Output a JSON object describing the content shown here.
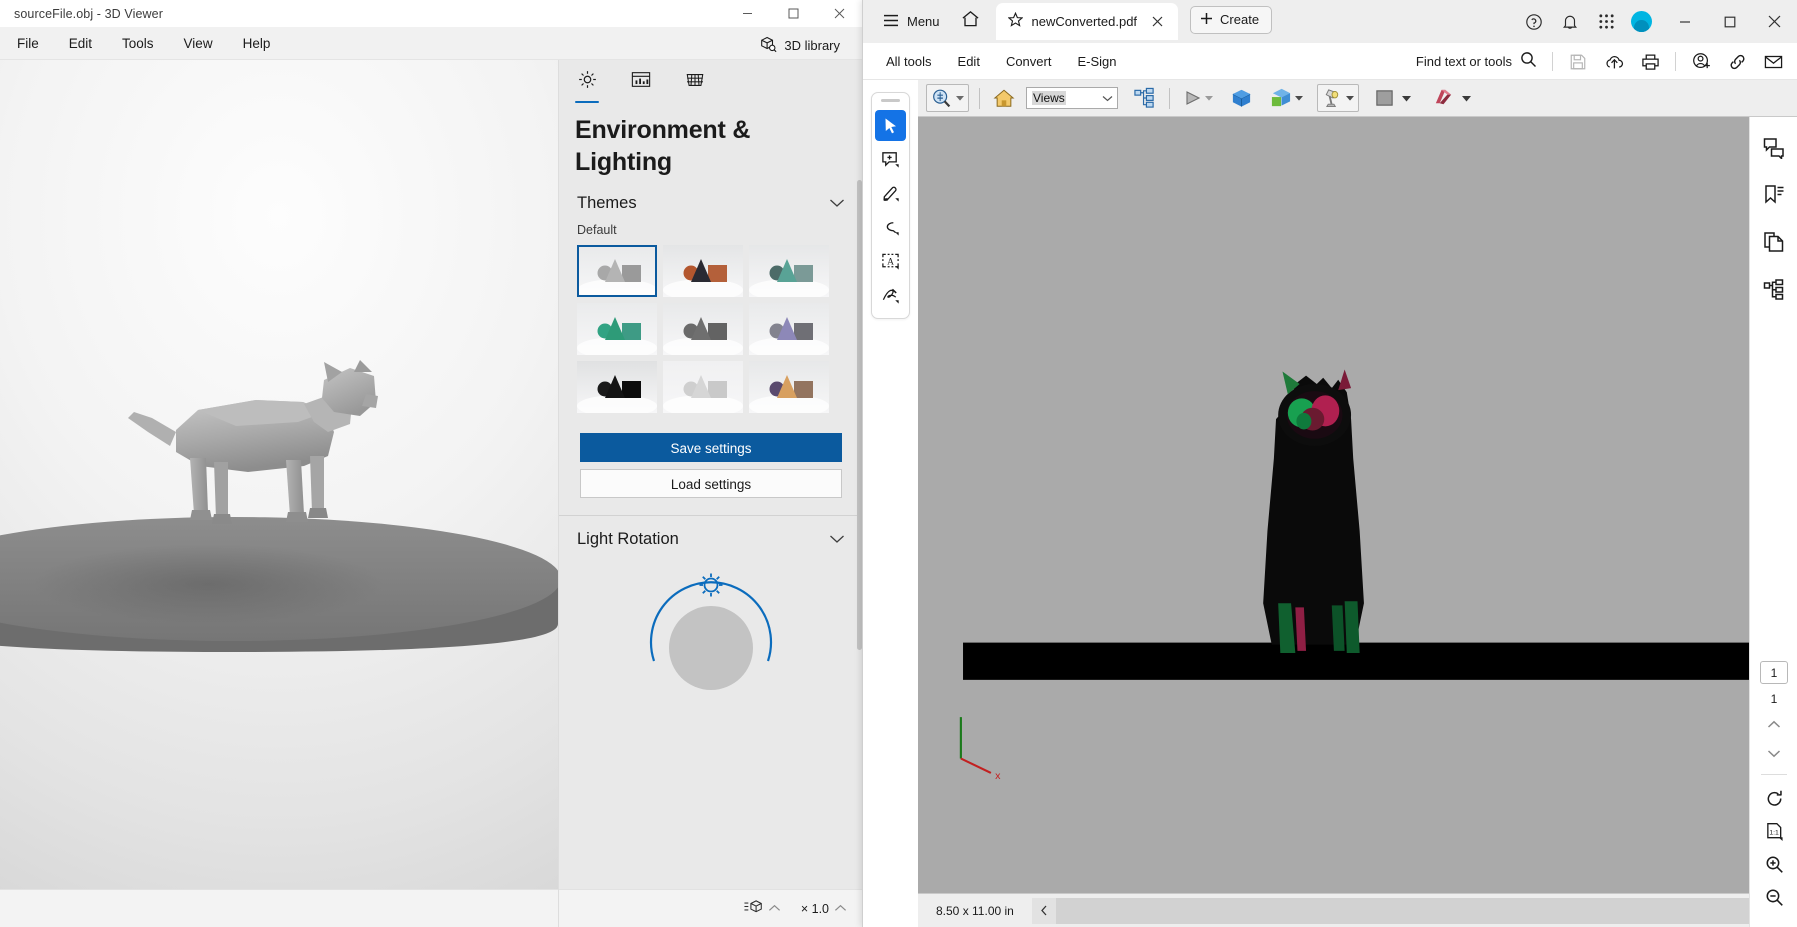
{
  "viewer": {
    "title": "sourceFile.obj - 3D Viewer",
    "window_controls": [
      {
        "name": "minimize-button",
        "glyph": "minimize"
      },
      {
        "name": "maximize-button",
        "glyph": "maximize"
      },
      {
        "name": "close-button",
        "glyph": "close"
      }
    ],
    "menu": [
      "File",
      "Edit",
      "Tools",
      "View",
      "Help"
    ],
    "library_button": {
      "label": "3D library",
      "icon": "cube-search-icon"
    },
    "panel": {
      "tabs": [
        {
          "name": "environment-lighting-tab",
          "icon": "sun-icon",
          "active": true
        },
        {
          "name": "statistics-tab",
          "icon": "chart-panel-icon",
          "active": false
        },
        {
          "name": "grid-tab",
          "icon": "grid-icon",
          "active": false
        }
      ],
      "title": "Environment & Lighting",
      "themes": {
        "section_label": "Themes",
        "group_label": "Default",
        "items": [
          {
            "name": "theme-default",
            "selected": true,
            "cone": "#b4b4b4",
            "sphere": "#a8a8a8",
            "box": "#9a9a9a",
            "bg": "#e8e9ea"
          },
          {
            "name": "theme-ember",
            "selected": false,
            "cone": "#2a2a33",
            "sphere": "#b3562e",
            "box": "#b4603a",
            "bg": "#e4e5e6"
          },
          {
            "name": "theme-teal",
            "selected": false,
            "cone": "#59a396",
            "sphere": "#4c6b68",
            "box": "#7b9a97",
            "bg": "#e6e7e8"
          },
          {
            "name": "theme-green",
            "selected": false,
            "cone": "#2e9b78",
            "sphere": "#31a383",
            "box": "#3e9b85",
            "bg": "#eaebec"
          },
          {
            "name": "theme-grey",
            "selected": false,
            "cone": "#6f6f6f",
            "sphere": "#6a6a6a",
            "box": "#636363",
            "bg": "#e8e9ea"
          },
          {
            "name": "theme-violet",
            "selected": false,
            "cone": "#8d88b8",
            "sphere": "#83838f",
            "box": "#6f6f75",
            "bg": "#e9eaeb"
          },
          {
            "name": "theme-night",
            "selected": false,
            "cone": "#151515",
            "sphere": "#1b1b1b",
            "box": "#0d0d0d",
            "bg": "#e0e1e2"
          },
          {
            "name": "theme-light",
            "selected": false,
            "cone": "#d6d6d6",
            "sphere": "#cfcfcf",
            "box": "#c9c9c9",
            "bg": "#f0f0f1"
          },
          {
            "name": "theme-sunset",
            "selected": false,
            "cone": "#d8a060",
            "sphere": "#5a4a6e",
            "box": "#93745f",
            "bg": "#e7e8e9"
          }
        ]
      },
      "save_button": "Save settings",
      "load_button": "Load settings",
      "light_rotation": {
        "section_label": "Light Rotation"
      },
      "status": {
        "model_icon_label": "model-stats-icon",
        "zoom_label": "× 1.0"
      }
    }
  },
  "acrobat": {
    "menu_button": "Menu",
    "tab": {
      "name": "newConverted.pdf",
      "star_icon": "star-icon",
      "close_icon": "close-icon"
    },
    "create_button": "Create",
    "header_icons": [
      {
        "name": "help-icon",
        "glyph": "?"
      },
      {
        "name": "notifications-bell-icon",
        "glyph": "bell"
      },
      {
        "name": "app-grid-icon",
        "glyph": "grid"
      }
    ],
    "window_controls": [
      {
        "name": "minimize-button"
      },
      {
        "name": "maximize-button"
      },
      {
        "name": "close-button"
      }
    ],
    "menubar": [
      "All tools",
      "Edit",
      "Convert",
      "E-Sign"
    ],
    "find": {
      "label": "Find text or tools",
      "icon": "search-icon"
    },
    "action_icons": [
      {
        "name": "save-icon",
        "disabled": true
      },
      {
        "name": "upload-cloud-icon",
        "disabled": false
      },
      {
        "name": "print-icon",
        "disabled": false
      },
      {
        "name": "add-person-icon",
        "disabled": false
      },
      {
        "name": "link-icon",
        "disabled": false
      },
      {
        "name": "email-icon",
        "disabled": false
      }
    ],
    "left_rail": [
      {
        "name": "select-tool",
        "icon": "cursor-arrow-icon",
        "active": true
      },
      {
        "name": "add-comment-tool",
        "icon": "comment-plus-icon",
        "active": false
      },
      {
        "name": "highlight-tool",
        "icon": "highlighter-icon",
        "active": false
      },
      {
        "name": "draw-tool",
        "icon": "lasso-icon",
        "active": false
      },
      {
        "name": "text-select-tool",
        "icon": "text-box-icon",
        "active": false
      },
      {
        "name": "signature-tool",
        "icon": "signature-pen-icon",
        "active": false
      }
    ],
    "pdf_toolbar": {
      "rotate_tool": "rotate-3d-icon",
      "home_view": "home-icon",
      "views_value": "Views",
      "model_tree": "model-tree-icon",
      "play": "play-icon",
      "cube_blue": "blue-cube-icon",
      "cube_green": "green-cube-icon",
      "lighting": "desk-lamp-icon",
      "background_color": "background-swatch-icon",
      "cross_section": "cross-section-icon"
    },
    "status": {
      "page_size": "8.50 x 11.00 in",
      "collapse_icon": "chevron-left-icon"
    },
    "right_rail": [
      {
        "name": "comment-panel-icon"
      },
      {
        "name": "bookmarks-panel-icon"
      },
      {
        "name": "page-thumbnails-icon"
      },
      {
        "name": "model-tree-panel-icon"
      }
    ],
    "page_nav": {
      "current_page": "1",
      "total_pages": "1",
      "prev_icon": "chevron-up-icon",
      "next_icon": "chevron-down-icon"
    },
    "page_actions": [
      {
        "name": "rotate-page-icon"
      },
      {
        "name": "fit-actual-size-icon"
      },
      {
        "name": "zoom-in-icon"
      },
      {
        "name": "zoom-out-icon"
      }
    ]
  },
  "colors": {
    "accent_blue": "#0b5a9e",
    "acrobat_blue": "#1473e6",
    "avatar_cyan": "#00b5e2",
    "pdf_canvas_gray": "#aaaaaa"
  }
}
